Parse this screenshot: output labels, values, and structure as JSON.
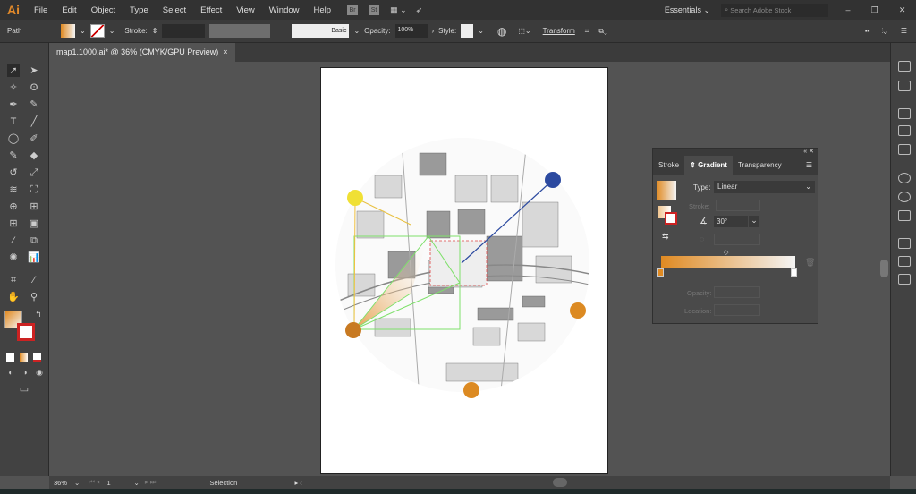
{
  "app": {
    "logo": "Ai",
    "menu": [
      "File",
      "Edit",
      "Object",
      "Type",
      "Select",
      "Effect",
      "View",
      "Window",
      "Help"
    ],
    "bridge": "Br",
    "stock": "St",
    "workspace": "Essentials",
    "search_placeholder": "Search Adobe Stock"
  },
  "control": {
    "selection_type": "Path",
    "stroke_label": "Stroke:",
    "brush": "Basic",
    "opacity_label": "Opacity:",
    "opacity": "100%",
    "style_label": "Style:",
    "transform": "Transform"
  },
  "document": {
    "tab_title": "map1.1000.ai* @ 36% (CMYK/GPU Preview)",
    "close": "×"
  },
  "gradient_panel": {
    "tabs": [
      "Stroke",
      "Gradient",
      "Transparency"
    ],
    "type_label": "Type:",
    "type": "Linear",
    "stroke_label": "Stroke:",
    "angle": "30°",
    "opacity_label": "Opacity:",
    "location_label": "Location:",
    "gradient_start": "#e08a22",
    "gradient_end": "#f4f4f4"
  },
  "status": {
    "zoom": "36%",
    "page": "1",
    "tool": "Selection"
  },
  "colors": {
    "yellow": "#f0e034",
    "blue": "#2c4aa0",
    "orange": "#dc8a22"
  }
}
